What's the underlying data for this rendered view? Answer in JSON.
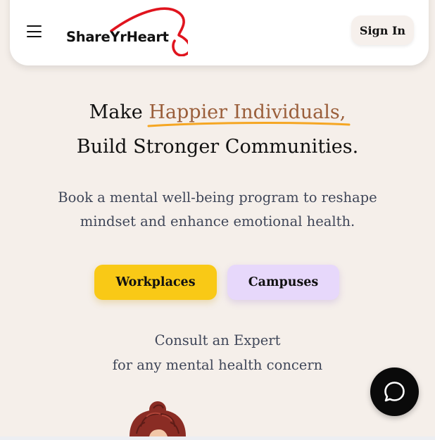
{
  "header": {
    "logo_text": "ShareYrHeart",
    "sign_in_label": "Sign In",
    "menu_icon": "hamburger-menu-icon",
    "brand_color": "#e0141e"
  },
  "hero": {
    "line1_prefix": "Make ",
    "line1_highlight": "Happier Individuals,",
    "line2": "Build Stronger Communities.",
    "highlight_color": "#9a5e3a",
    "underline_color": "#f5a623"
  },
  "subtitle": {
    "line1": "Book a mental well-being program to reshape",
    "line2": "mindset and enhance emotional health."
  },
  "cta": {
    "workplaces_label": "Workplaces",
    "campuses_label": "Campuses",
    "workplaces_color": "#f9c916",
    "campuses_color": "#e7d8fb"
  },
  "consult": {
    "line1": "Consult an Expert",
    "line2": "for any mental health concern"
  },
  "chat": {
    "icon": "chat-bubble-icon"
  },
  "avatar": {
    "icon": "expert-avatar-illustration"
  }
}
